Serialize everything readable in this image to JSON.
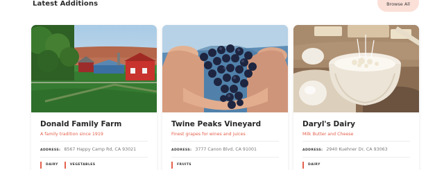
{
  "section": {
    "title": "Latest Additions",
    "browse_label": "Browse All"
  },
  "accent_color": "#e3604c",
  "button_color": "#fbe0d8",
  "cards": [
    {
      "title": "Donald Family Farm",
      "subtitle": "A family tradition since 1919",
      "address_label": "ADDRESS:",
      "address": "8567 Happy Camp Rd, CA 93021",
      "tags": [
        "DAIRY",
        "VEGETABLES"
      ],
      "image": "farm-photo"
    },
    {
      "title": "Twine Peaks Vineyard",
      "subtitle": "Finest grapes for wines and juices",
      "address_label": "ADDRESS:",
      "address": "3777 Canon Blvd, CA 91001",
      "tags": [
        "FRUITS"
      ],
      "image": "grapes-photo"
    },
    {
      "title": "Daryl's Dairy",
      "subtitle": "Milk Butter and Cheese",
      "address_label": "ADDRESS:",
      "address": "2940 Kuehner Dr, CA 93063",
      "tags": [
        "DAIRY"
      ],
      "image": "dairy-photo"
    }
  ]
}
